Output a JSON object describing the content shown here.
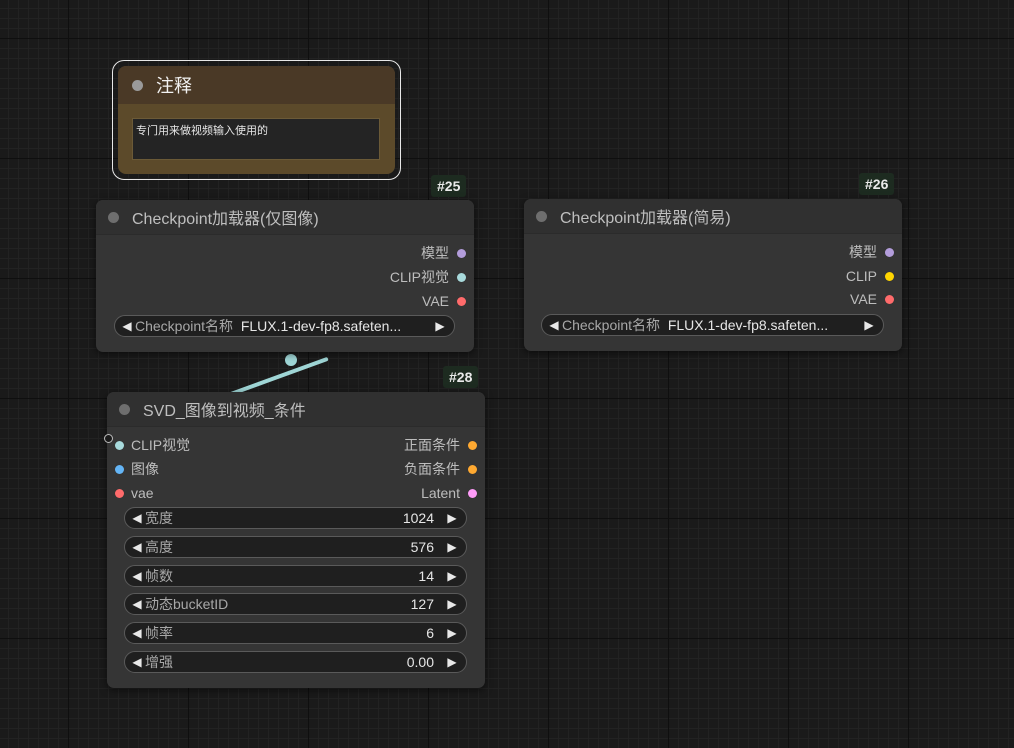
{
  "note": {
    "title": "注释",
    "text": "专门用来做视频输入使用的"
  },
  "node25": {
    "id": "#25",
    "title": "Checkpoint加载器(仅图像)",
    "outputs": [
      {
        "label": "模型",
        "color": "#b39ddb"
      },
      {
        "label": "CLIP视觉",
        "color": "#a8dadc"
      },
      {
        "label": "VAE",
        "color": "#ff6b6b"
      }
    ],
    "widget": {
      "label": "Checkpoint名称",
      "value": "FLUX.1-dev-fp8.safeten..."
    }
  },
  "node26": {
    "id": "#26",
    "title": "Checkpoint加载器(简易)",
    "outputs": [
      {
        "label": "模型",
        "color": "#b39ddb"
      },
      {
        "label": "CLIP",
        "color": "#ffd500"
      },
      {
        "label": "VAE",
        "color": "#ff6b6b"
      }
    ],
    "widget": {
      "label": "Checkpoint名称",
      "value": "FLUX.1-dev-fp8.safeten..."
    }
  },
  "node28": {
    "id": "#28",
    "title": "SVD_图像到视频_条件",
    "inputs": [
      {
        "label": "CLIP视觉",
        "color": "#a8dadc"
      },
      {
        "label": "图像",
        "color": "#64b5f6"
      },
      {
        "label": "vae",
        "color": "#ff6b6b"
      }
    ],
    "outputs": [
      {
        "label": "正面条件",
        "color": "#ffa931"
      },
      {
        "label": "负面条件",
        "color": "#ffa931"
      },
      {
        "label": "Latent",
        "color": "#ff9cf9"
      }
    ],
    "widgets": [
      {
        "label": "宽度",
        "value": "1024"
      },
      {
        "label": "高度",
        "value": "576"
      },
      {
        "label": "帧数",
        "value": "14"
      },
      {
        "label": "动态bucketID",
        "value": "127"
      },
      {
        "label": "帧率",
        "value": "6"
      },
      {
        "label": "增强",
        "value": "0.00"
      }
    ]
  },
  "icons": {
    "left_arrow": "◀",
    "right_arrow": "▶"
  },
  "colors": {
    "link": "#9fd6d6",
    "note_body": "#5c4a2a",
    "node_body": "#353535"
  }
}
